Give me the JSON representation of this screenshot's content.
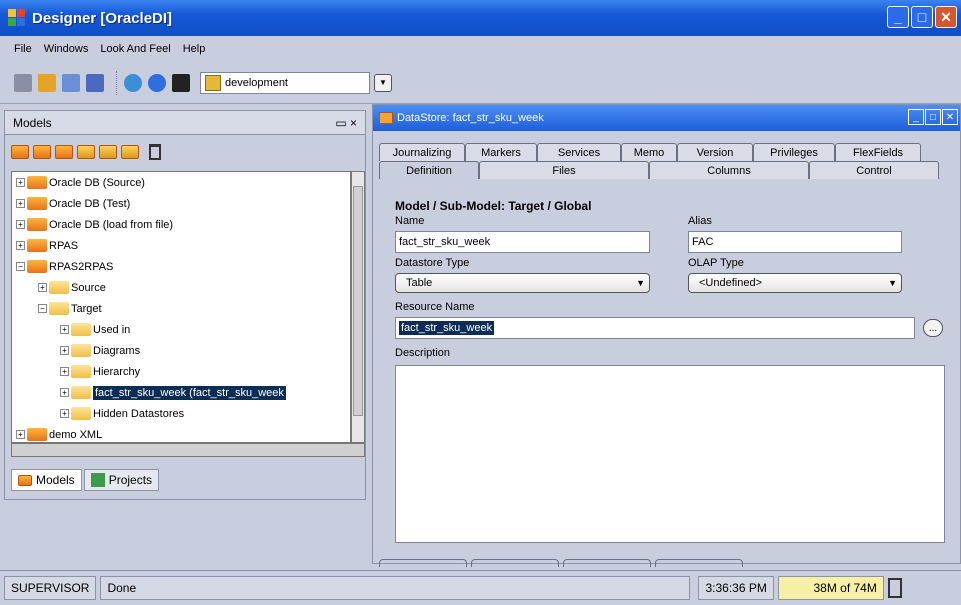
{
  "window": {
    "title": "Designer [OracleDI]"
  },
  "menu": [
    "File",
    "Windows",
    "Look And Feel",
    "Help"
  ],
  "toolbar": {
    "context_value": "development"
  },
  "models_panel": {
    "title": "Models",
    "close": "×",
    "tree": [
      {
        "label": "Oracle DB (Source)",
        "exp": "+",
        "level": 0
      },
      {
        "label": "Oracle DB (Test)",
        "exp": "+",
        "level": 0
      },
      {
        "label": "Oracle DB (load from file)",
        "exp": "+",
        "level": 0
      },
      {
        "label": "RPAS",
        "exp": "+",
        "level": 0
      },
      {
        "label": "RPAS2RPAS",
        "exp": "−",
        "level": 0
      },
      {
        "label": "Source",
        "exp": "+",
        "level": 1
      },
      {
        "label": "Target",
        "exp": "−",
        "level": 1
      },
      {
        "label": "Used in",
        "exp": "+",
        "level": 2
      },
      {
        "label": "Diagrams",
        "exp": "+",
        "level": 2
      },
      {
        "label": "Hierarchy",
        "exp": "+",
        "level": 2
      },
      {
        "label": "fact_str_sku_week (fact_str_sku_week",
        "exp": "+",
        "level": 2,
        "selected": true
      },
      {
        "label": "Hidden Datastores",
        "exp": "+",
        "level": 2
      },
      {
        "label": "demo XML",
        "exp": "+",
        "level": 0
      }
    ],
    "tabs": [
      "Models",
      "Projects"
    ]
  },
  "datastore": {
    "title": "DataStore: fact_str_sku_week",
    "tabs_back": [
      "Journalizing",
      "Markers",
      "Services",
      "Memo",
      "Version",
      "Privileges",
      "FlexFields"
    ],
    "tabs_front": [
      "Definition",
      "Files",
      "Columns",
      "Control"
    ],
    "heading": "Model / Sub-Model: Target / Global",
    "name_label": "Name",
    "name_value": "fact_str_sku_week",
    "alias_label": "Alias",
    "alias_value": "FAC",
    "datastore_type_label": "Datastore Type",
    "datastore_type_value": "Table",
    "olap_type_label": "OLAP Type",
    "olap_type_value": "<Undefined>",
    "resource_name_label": "Resource Name",
    "resource_name_value": "fact_str_sku_week",
    "description_label": "Description",
    "dots": "..."
  },
  "status": {
    "user": "SUPERVISOR",
    "message": "Done",
    "time": "3:36:36 PM",
    "memory": "38M of 74M"
  }
}
